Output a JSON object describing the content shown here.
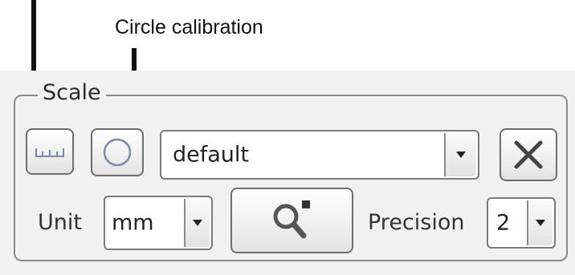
{
  "callout": {
    "circle_label": "Circle calibration"
  },
  "scale_group": {
    "title": "Scale",
    "line_calibration_icon": "ruler-icon",
    "circle_calibration_icon": "circle-icon",
    "profile_combo": {
      "value": "default"
    },
    "delete_icon": "close-icon",
    "unit_label": "Unit",
    "unit_combo": {
      "value": "mm"
    },
    "zoom_icon": "magnifier-icon",
    "precision_label": "Precision",
    "precision_combo": {
      "value": "2"
    }
  }
}
